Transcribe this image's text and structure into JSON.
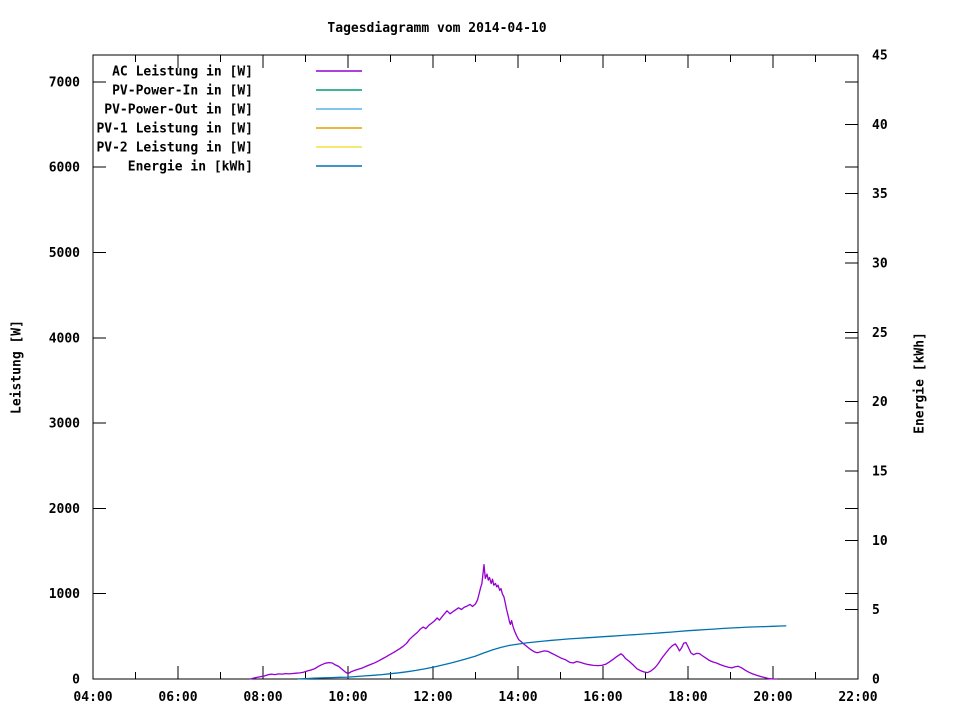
{
  "title": "Tagesdiagramm vom 2014-04-10",
  "axes": {
    "x": {
      "min_hour": 4,
      "max_hour": 22,
      "tick_labels": [
        "04:00",
        "06:00",
        "08:00",
        "10:00",
        "12:00",
        "14:00",
        "16:00",
        "18:00",
        "20:00",
        "22:00"
      ],
      "tick_hours": [
        4,
        6,
        8,
        10,
        12,
        14,
        16,
        18,
        20,
        22
      ],
      "minor_tick_hours": [
        5,
        7,
        9,
        11,
        13,
        15,
        17,
        19,
        21
      ]
    },
    "y_left": {
      "label": "Leistung [W]",
      "min": 0,
      "max": 7316,
      "tick_labels": [
        "0",
        "1000",
        "2000",
        "3000",
        "4000",
        "5000",
        "6000",
        "7000"
      ],
      "tick_values": [
        0,
        1000,
        2000,
        3000,
        4000,
        5000,
        6000,
        7000
      ]
    },
    "y_right": {
      "label": "Energie [kWh]",
      "min": 0,
      "max": 45,
      "tick_labels": [
        "0",
        "5",
        "10",
        "15",
        "20",
        "25",
        "30",
        "35",
        "40",
        "45"
      ],
      "tick_values": [
        0,
        5,
        10,
        15,
        20,
        25,
        30,
        35,
        40,
        45
      ]
    }
  },
  "legend": {
    "entries": [
      {
        "label": "AC Leistung in [W]",
        "color": "#9400d3"
      },
      {
        "label": "PV-Power-In in [W]",
        "color": "#009e73"
      },
      {
        "label": "PV-Power-Out in [W]",
        "color": "#56b4e9"
      },
      {
        "label": "PV-1 Leistung in [W]",
        "color": "#e69f00"
      },
      {
        "label": "PV-2 Leistung in [W]",
        "color": "#f0e442"
      },
      {
        "label": "Energie in [kWh]",
        "color": "#0072b2"
      }
    ]
  },
  "chart_data": {
    "type": "line",
    "title": "Tagesdiagramm vom 2014-04-10",
    "xlabel": "",
    "x_unit": "decimal_hours",
    "xlim": [
      4,
      22
    ],
    "ylim_left": [
      0,
      7316
    ],
    "ylim_right": [
      0,
      45
    ],
    "grid": false,
    "background": "#ffffff",
    "legend_position": "top-left-inside",
    "series": [
      {
        "name": "AC Leistung in [W]",
        "color": "#9400d3",
        "axis": "left",
        "points": [
          [
            7.7,
            0
          ],
          [
            7.78,
            10
          ],
          [
            7.87,
            20
          ],
          [
            7.95,
            28
          ],
          [
            8.03,
            35
          ],
          [
            8.12,
            50
          ],
          [
            8.2,
            58
          ],
          [
            8.28,
            52
          ],
          [
            8.37,
            60
          ],
          [
            8.45,
            57
          ],
          [
            8.53,
            63
          ],
          [
            8.62,
            60
          ],
          [
            8.7,
            65
          ],
          [
            8.78,
            68
          ],
          [
            8.87,
            72
          ],
          [
            8.95,
            80
          ],
          [
            9.05,
            95
          ],
          [
            9.13,
            105
          ],
          [
            9.22,
            122
          ],
          [
            9.3,
            148
          ],
          [
            9.38,
            168
          ],
          [
            9.47,
            185
          ],
          [
            9.55,
            192
          ],
          [
            9.63,
            188
          ],
          [
            9.7,
            165
          ],
          [
            9.78,
            148
          ],
          [
            9.85,
            118
          ],
          [
            9.93,
            85
          ],
          [
            10.0,
            62
          ],
          [
            10.07,
            85
          ],
          [
            10.15,
            100
          ],
          [
            10.23,
            112
          ],
          [
            10.32,
            125
          ],
          [
            10.42,
            148
          ],
          [
            10.53,
            170
          ],
          [
            10.63,
            190
          ],
          [
            10.73,
            215
          ],
          [
            10.82,
            240
          ],
          [
            10.9,
            262
          ],
          [
            10.98,
            285
          ],
          [
            11.07,
            310
          ],
          [
            11.15,
            335
          ],
          [
            11.23,
            360
          ],
          [
            11.3,
            385
          ],
          [
            11.38,
            420
          ],
          [
            11.45,
            465
          ],
          [
            11.5,
            490
          ],
          [
            11.57,
            520
          ],
          [
            11.63,
            545
          ],
          [
            11.7,
            585
          ],
          [
            11.77,
            610
          ],
          [
            11.83,
            590
          ],
          [
            11.9,
            630
          ],
          [
            11.97,
            655
          ],
          [
            12.03,
            680
          ],
          [
            12.1,
            715
          ],
          [
            12.15,
            690
          ],
          [
            12.22,
            735
          ],
          [
            12.28,
            770
          ],
          [
            12.33,
            800
          ],
          [
            12.4,
            765
          ],
          [
            12.47,
            790
          ],
          [
            12.53,
            810
          ],
          [
            12.6,
            835
          ],
          [
            12.67,
            815
          ],
          [
            12.73,
            840
          ],
          [
            12.8,
            855
          ],
          [
            12.87,
            875
          ],
          [
            12.93,
            850
          ],
          [
            13.0,
            880
          ],
          [
            13.05,
            930
          ],
          [
            13.08,
            990
          ],
          [
            13.12,
            1070
          ],
          [
            13.15,
            1120
          ],
          [
            13.2,
            1340
          ],
          [
            13.23,
            1180
          ],
          [
            13.27,
            1230
          ],
          [
            13.3,
            1160
          ],
          [
            13.33,
            1190
          ],
          [
            13.37,
            1120
          ],
          [
            13.4,
            1170
          ],
          [
            13.43,
            1100
          ],
          [
            13.47,
            1120
          ],
          [
            13.5,
            1080
          ],
          [
            13.53,
            1100
          ],
          [
            13.57,
            1040
          ],
          [
            13.6,
            1060
          ],
          [
            13.63,
            1000
          ],
          [
            13.67,
            960
          ],
          [
            13.7,
            890
          ],
          [
            13.73,
            820
          ],
          [
            13.77,
            740
          ],
          [
            13.8,
            670
          ],
          [
            13.82,
            640
          ],
          [
            13.85,
            685
          ],
          [
            13.88,
            620
          ],
          [
            13.92,
            560
          ],
          [
            13.97,
            505
          ],
          [
            14.02,
            460
          ],
          [
            14.08,
            435
          ],
          [
            14.15,
            405
          ],
          [
            14.22,
            375
          ],
          [
            14.3,
            345
          ],
          [
            14.38,
            320
          ],
          [
            14.45,
            308
          ],
          [
            14.53,
            318
          ],
          [
            14.62,
            330
          ],
          [
            14.7,
            325
          ],
          [
            14.78,
            305
          ],
          [
            14.87,
            282
          ],
          [
            14.95,
            262
          ],
          [
            15.03,
            242
          ],
          [
            15.12,
            225
          ],
          [
            15.22,
            195
          ],
          [
            15.3,
            188
          ],
          [
            15.38,
            205
          ],
          [
            15.47,
            195
          ],
          [
            15.57,
            178
          ],
          [
            15.67,
            168
          ],
          [
            15.78,
            160
          ],
          [
            15.88,
            157
          ],
          [
            15.97,
            160
          ],
          [
            16.07,
            175
          ],
          [
            16.15,
            200
          ],
          [
            16.23,
            228
          ],
          [
            16.32,
            262
          ],
          [
            16.42,
            295
          ],
          [
            16.47,
            278
          ],
          [
            16.53,
            240
          ],
          [
            16.62,
            205
          ],
          [
            16.72,
            160
          ],
          [
            16.8,
            120
          ],
          [
            16.88,
            98
          ],
          [
            16.97,
            82
          ],
          [
            17.05,
            75
          ],
          [
            17.13,
            95
          ],
          [
            17.22,
            130
          ],
          [
            17.3,
            180
          ],
          [
            17.38,
            240
          ],
          [
            17.47,
            300
          ],
          [
            17.55,
            350
          ],
          [
            17.63,
            390
          ],
          [
            17.7,
            412
          ],
          [
            17.75,
            375
          ],
          [
            17.8,
            330
          ],
          [
            17.85,
            365
          ],
          [
            17.9,
            420
          ],
          [
            17.95,
            428
          ],
          [
            18.0,
            380
          ],
          [
            18.07,
            305
          ],
          [
            18.13,
            285
          ],
          [
            18.2,
            300
          ],
          [
            18.27,
            298
          ],
          [
            18.33,
            275
          ],
          [
            18.42,
            245
          ],
          [
            18.5,
            218
          ],
          [
            18.58,
            200
          ],
          [
            18.67,
            188
          ],
          [
            18.75,
            170
          ],
          [
            18.85,
            152
          ],
          [
            18.95,
            138
          ],
          [
            19.03,
            130
          ],
          [
            19.1,
            142
          ],
          [
            19.18,
            150
          ],
          [
            19.27,
            128
          ],
          [
            19.35,
            102
          ],
          [
            19.43,
            80
          ],
          [
            19.52,
            60
          ],
          [
            19.62,
            42
          ],
          [
            19.72,
            28
          ],
          [
            19.82,
            14
          ],
          [
            19.92,
            4
          ],
          [
            20.02,
            0
          ],
          [
            20.08,
            0
          ]
        ]
      },
      {
        "name": "PV-Power-In in [W]",
        "color": "#009e73",
        "axis": "left",
        "points": []
      },
      {
        "name": "PV-Power-Out in [W]",
        "color": "#56b4e9",
        "axis": "left",
        "points": []
      },
      {
        "name": "PV-1 Leistung in [W]",
        "color": "#e69f00",
        "axis": "left",
        "points": []
      },
      {
        "name": "PV-2 Leistung in [W]",
        "color": "#f0e442",
        "axis": "left",
        "points": []
      },
      {
        "name": "Energie in [kWh]",
        "color": "#0072b2",
        "axis": "right",
        "points": [
          [
            8.83,
            0.01
          ],
          [
            9.0,
            0.03
          ],
          [
            9.2,
            0.06
          ],
          [
            9.4,
            0.08
          ],
          [
            9.6,
            0.1
          ],
          [
            9.8,
            0.12
          ],
          [
            10.0,
            0.14
          ],
          [
            10.2,
            0.18
          ],
          [
            10.4,
            0.22
          ],
          [
            10.6,
            0.27
          ],
          [
            10.8,
            0.32
          ],
          [
            11.0,
            0.38
          ],
          [
            11.2,
            0.45
          ],
          [
            11.4,
            0.53
          ],
          [
            11.6,
            0.62
          ],
          [
            11.8,
            0.73
          ],
          [
            12.0,
            0.85
          ],
          [
            12.2,
            0.99
          ],
          [
            12.4,
            1.14
          ],
          [
            12.6,
            1.3
          ],
          [
            12.8,
            1.47
          ],
          [
            13.0,
            1.65
          ],
          [
            13.2,
            1.88
          ],
          [
            13.4,
            2.1
          ],
          [
            13.6,
            2.28
          ],
          [
            13.8,
            2.42
          ],
          [
            14.0,
            2.52
          ],
          [
            14.2,
            2.6
          ],
          [
            14.4,
            2.67
          ],
          [
            14.6,
            2.73
          ],
          [
            14.8,
            2.79
          ],
          [
            15.0,
            2.84
          ],
          [
            15.2,
            2.89
          ],
          [
            15.4,
            2.93
          ],
          [
            15.6,
            2.97
          ],
          [
            15.8,
            3.01
          ],
          [
            16.0,
            3.05
          ],
          [
            16.2,
            3.09
          ],
          [
            16.4,
            3.13
          ],
          [
            16.6,
            3.17
          ],
          [
            16.8,
            3.21
          ],
          [
            17.0,
            3.25
          ],
          [
            17.2,
            3.29
          ],
          [
            17.4,
            3.34
          ],
          [
            17.6,
            3.38
          ],
          [
            17.8,
            3.43
          ],
          [
            18.0,
            3.48
          ],
          [
            18.2,
            3.52
          ],
          [
            18.4,
            3.56
          ],
          [
            18.6,
            3.6
          ],
          [
            18.8,
            3.64
          ],
          [
            19.0,
            3.68
          ],
          [
            19.2,
            3.71
          ],
          [
            19.4,
            3.74
          ],
          [
            19.6,
            3.76
          ],
          [
            19.8,
            3.78
          ],
          [
            20.0,
            3.8
          ],
          [
            20.17,
            3.82
          ],
          [
            20.3,
            3.83
          ]
        ]
      }
    ]
  }
}
